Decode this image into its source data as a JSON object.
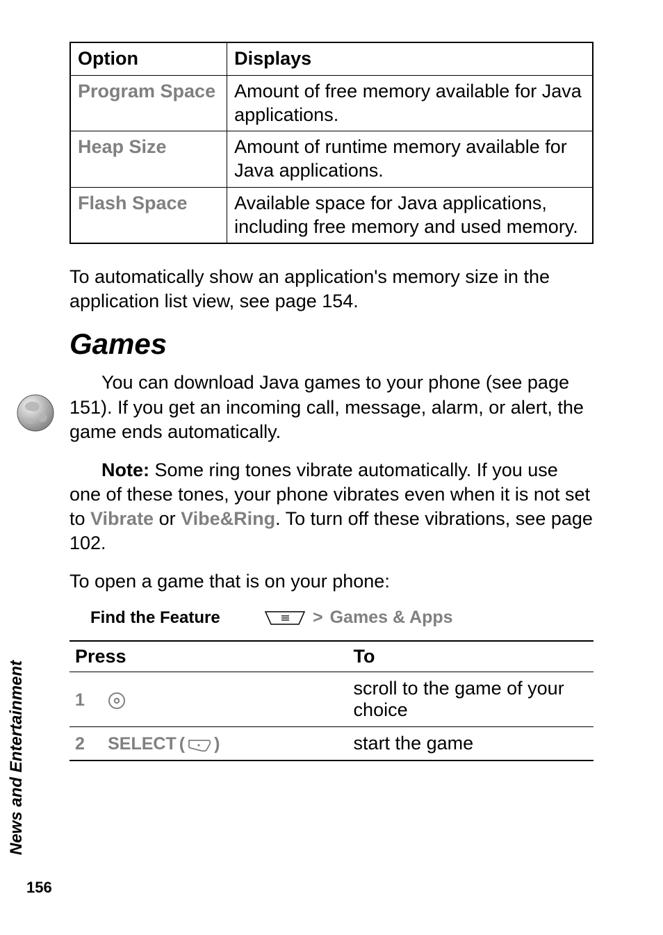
{
  "sidebar": {
    "section": "News and Entertainment",
    "page_number": "156"
  },
  "options_table": {
    "headers": {
      "option": "Option",
      "displays": "Displays"
    },
    "rows": [
      {
        "option": "Program Space",
        "displays": "Amount of free memory available for Java applications."
      },
      {
        "option": "Heap Size",
        "displays": "Amount of runtime memory available for Java applications."
      },
      {
        "option": "Flash Space",
        "displays": "Available space for Java applications, including free memory and used memory."
      }
    ]
  },
  "paragraphs": {
    "memory_note": "To automatically show an application's memory size in the application list view, see page 154."
  },
  "section": {
    "title": "Games",
    "intro": "You can download Java games to your phone (see page 151). If you get an incoming call, message, alarm, or alert, the game ends automatically.",
    "note_prefix": "Note: ",
    "note_body_1": "Some ring tones vibrate automatically. If you use one of these tones, your phone vibrates even when it is not set to ",
    "vibrate_label": "Vibrate",
    "note_or": " or ",
    "vibe_ring_label": "Vibe&Ring",
    "note_body_2": ". To turn off these vibrations, see page 102.",
    "open_intro": "To open a game that is on your phone:"
  },
  "feature": {
    "label": "Find the Feature",
    "arrow": ">",
    "path": "Games & Apps"
  },
  "press_table": {
    "headers": {
      "press": "Press",
      "to": "To"
    },
    "rows": [
      {
        "num": "1",
        "action_icon": "nav-key",
        "action_label": "",
        "to": "scroll to the game of your choice"
      },
      {
        "num": "2",
        "action_icon": "softkey",
        "action_label": "SELECT",
        "to": "start the game"
      }
    ]
  }
}
